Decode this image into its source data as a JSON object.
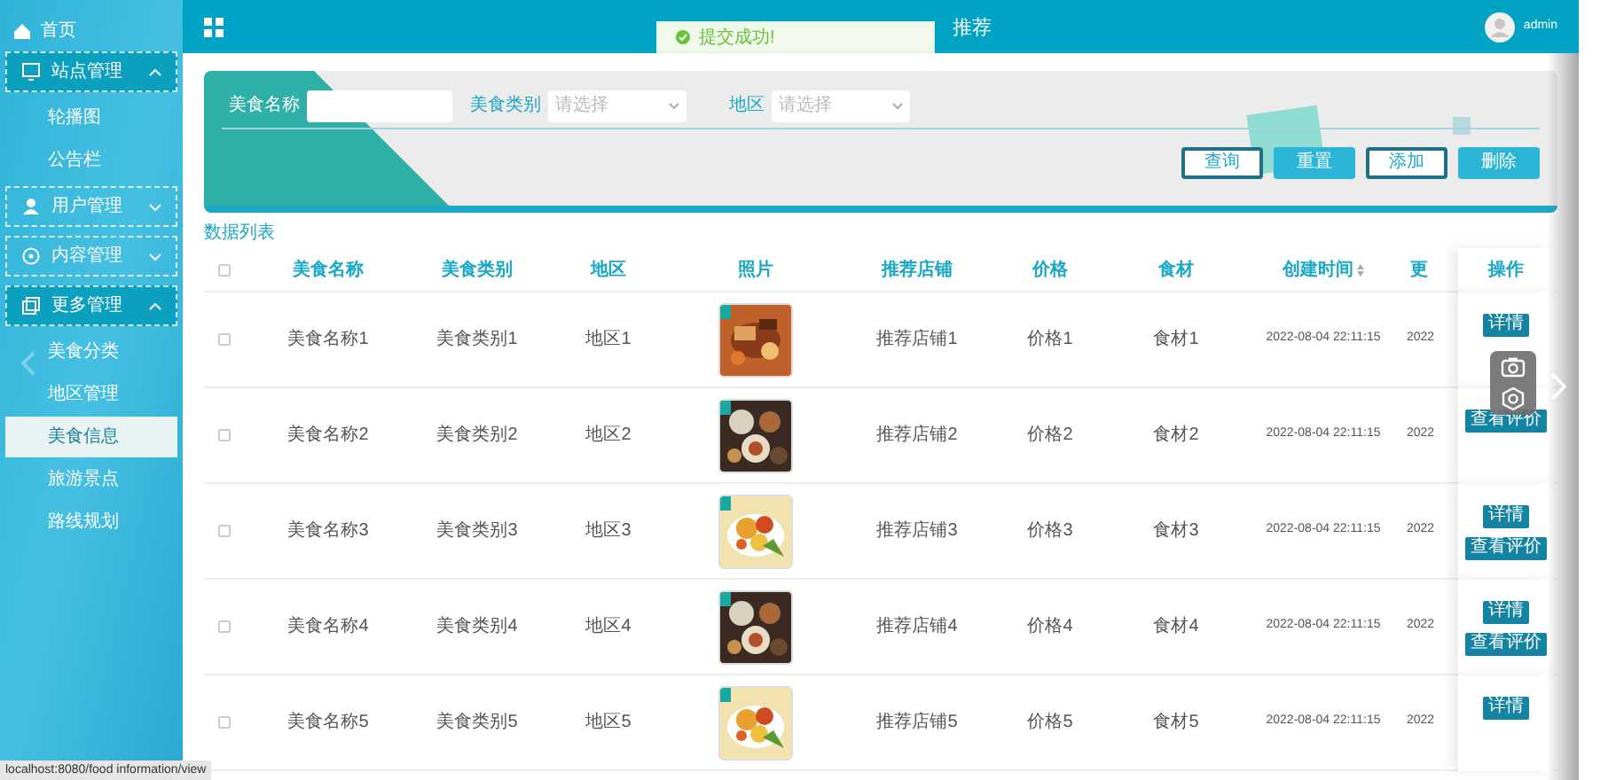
{
  "sidebar": {
    "items": [
      {
        "label": "首页",
        "kind": "link",
        "selected": false
      },
      {
        "label": "站点管理",
        "kind": "group",
        "expanded": true,
        "children": [
          {
            "label": "轮播图",
            "selected": false
          },
          {
            "label": "公告栏",
            "selected": false
          }
        ]
      },
      {
        "label": "用户管理",
        "kind": "group",
        "expanded": false
      },
      {
        "label": "内容管理",
        "kind": "group",
        "expanded": false
      },
      {
        "label": "更多管理",
        "kind": "group",
        "expanded": true,
        "children": [
          {
            "label": "美食分类",
            "selected": false
          },
          {
            "label": "地区管理",
            "selected": false
          },
          {
            "label": "美食信息",
            "selected": true
          },
          {
            "label": "旅游景点",
            "selected": false
          },
          {
            "label": "路线规划",
            "selected": false
          }
        ]
      }
    ]
  },
  "topbar": {
    "title": "推荐",
    "user": "admin"
  },
  "toast": {
    "text": "提交成功!"
  },
  "search": {
    "fields": [
      {
        "label": "美食名称",
        "kind": "input"
      },
      {
        "label": "美食类别",
        "kind": "select",
        "placeholder": "请选择"
      },
      {
        "label": "地区",
        "kind": "select",
        "placeholder": "请选择"
      }
    ],
    "buttons": [
      {
        "label": "查询",
        "kind": "outline"
      },
      {
        "label": "重置",
        "kind": "filled"
      },
      {
        "label": "添加",
        "kind": "outline"
      },
      {
        "label": "删除",
        "kind": "filled"
      }
    ]
  },
  "table": {
    "caption": "数据列表",
    "all_checked": false,
    "columns": [
      {
        "label": "美食名称",
        "sortable": false
      },
      {
        "label": "美食类别",
        "sortable": false
      },
      {
        "label": "地区",
        "sortable": false
      },
      {
        "label": "照片",
        "sortable": false
      },
      {
        "label": "推荐店铺",
        "sortable": false
      },
      {
        "label": "价格",
        "sortable": false
      },
      {
        "label": "食材",
        "sortable": false
      },
      {
        "label": "创建时间",
        "sortable": true
      },
      {
        "label": "更",
        "sortable": false
      },
      {
        "label": "操作",
        "sortable": false
      }
    ],
    "rows": [
      {
        "checked": false,
        "cells": [
          "美食名称1",
          "美食类别1",
          "地区1",
          {
            "kind": "picture"
          },
          "推荐店铺1",
          "价格1",
          "食材1",
          "2022-08-04 22:11:15",
          "2022"
        ],
        "actions": [
          "详情"
        ]
      },
      {
        "checked": false,
        "cells": [
          "美食名称2",
          "美食类别2",
          "地区2",
          {
            "kind": "picture"
          },
          "推荐店铺2",
          "价格2",
          "食材2",
          "2022-08-04 22:11:15",
          "2022"
        ],
        "actions": [
          "查看评价"
        ]
      },
      {
        "checked": false,
        "cells": [
          "美食名称3",
          "美食类别3",
          "地区3",
          {
            "kind": "picture"
          },
          "推荐店铺3",
          "价格3",
          "食材3",
          "2022-08-04 22:11:15",
          "2022"
        ],
        "actions": [
          "详情",
          "查看评价"
        ]
      },
      {
        "checked": false,
        "cells": [
          "美食名称4",
          "美食类别4",
          "地区4",
          {
            "kind": "picture"
          },
          "推荐店铺4",
          "价格4",
          "食材4",
          "2022-08-04 22:11:15",
          "2022"
        ],
        "actions": [
          "详情",
          "查看评价"
        ]
      },
      {
        "checked": false,
        "cells": [
          "美食名称5",
          "美食类别5",
          "地区5",
          {
            "kind": "picture"
          },
          "推荐店铺5",
          "价格5",
          "食材5",
          "2022-08-04 22:11:15",
          "2022"
        ],
        "actions": [
          "详情"
        ]
      }
    ]
  },
  "status_bar": {
    "url": "localhost:8080/food information/view"
  }
}
